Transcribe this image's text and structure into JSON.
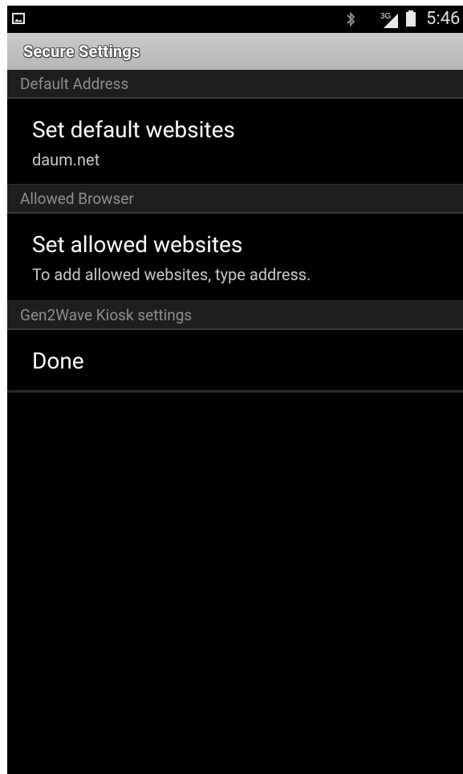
{
  "status_bar": {
    "time": "5:46",
    "network": "3G",
    "icons": [
      "image-icon",
      "bluetooth-icon",
      "signal-icon",
      "battery-icon"
    ]
  },
  "title_bar": {
    "title": "Secure Settings"
  },
  "sections": [
    {
      "header": "Default Address",
      "item": {
        "title": "Set default websites",
        "summary": "daum.net"
      }
    },
    {
      "header": "Allowed Browser",
      "item": {
        "title": "Set allowed websites",
        "summary": "To add allowed websites, type address."
      }
    },
    {
      "header": "Gen2Wave Kiosk settings",
      "item": {
        "title": "Done",
        "summary": ""
      }
    }
  ],
  "colors": {
    "background": "#000000",
    "title_bar": "#c0c0c0",
    "section_header_bg": "#1e1e1e",
    "section_header_text": "#8f8f8f",
    "item_title": "#ffffff",
    "item_summary": "#c8c8c8"
  }
}
